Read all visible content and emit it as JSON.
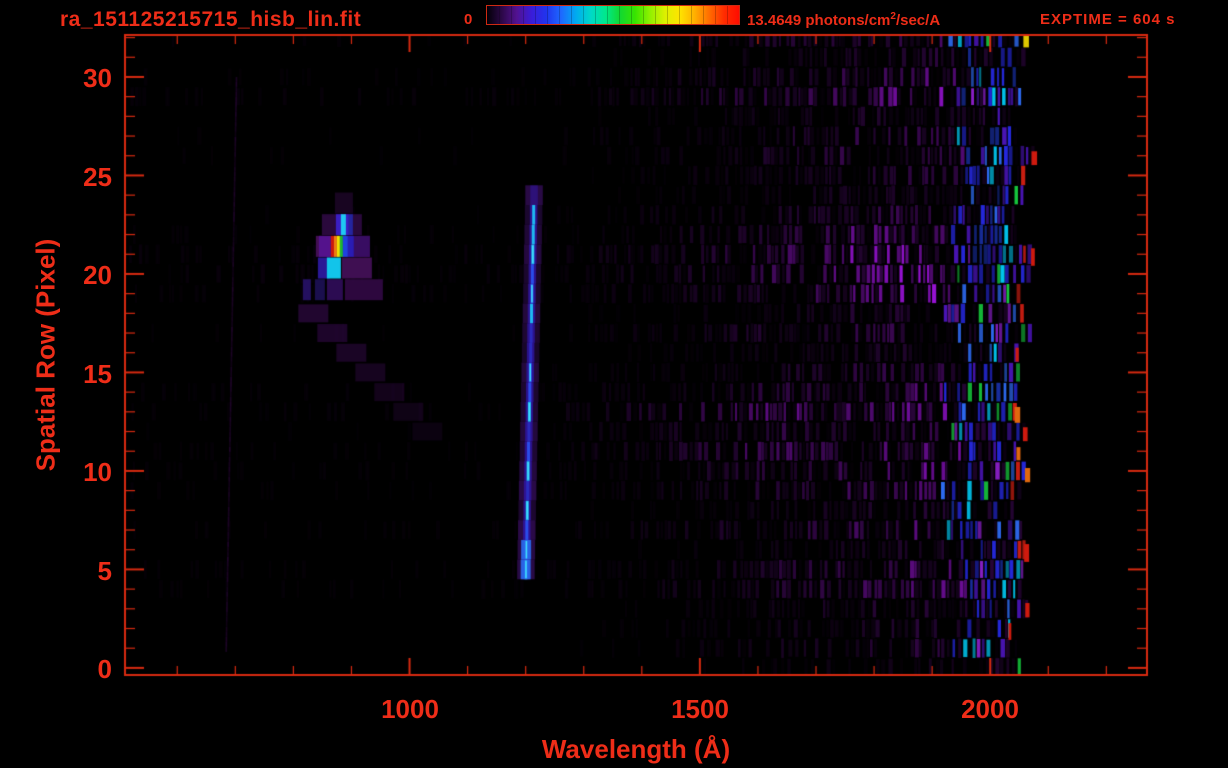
{
  "header": {
    "title": "ra_151125215715_hisb_lin.fit",
    "exptime": "EXPTIME = 604 s"
  },
  "colorbar": {
    "min_label": "0",
    "max_label_pre": "13.4649 photons/cm",
    "max_label_sup": "2",
    "max_label_post": "/sec/A",
    "gradient_stops": [
      "#020006",
      "#2c0848",
      "#521290",
      "#3a1cd8",
      "#2134ee",
      "#1e68ff",
      "#00aaf0",
      "#00d8c8",
      "#00e88c",
      "#12d830",
      "#38e400",
      "#90f000",
      "#dcf000",
      "#ffe400",
      "#ffb000",
      "#ff6c00",
      "#ff2c00",
      "#ff0c00"
    ]
  },
  "axes": {
    "x": {
      "title": "Wavelength (Å)",
      "tick_labels": [
        {
          "value": 1000,
          "label": "1000"
        },
        {
          "value": 1500,
          "label": "1500"
        },
        {
          "value": 2000,
          "label": "2000"
        }
      ]
    },
    "y": {
      "title": "Spatial Row (Pixel)",
      "tick_labels": [
        {
          "value": 30,
          "label": "30"
        },
        {
          "value": 25,
          "label": "25"
        },
        {
          "value": 20,
          "label": "20"
        },
        {
          "value": 15,
          "label": "15"
        },
        {
          "value": 10,
          "label": "10"
        },
        {
          "value": 5,
          "label": "5"
        },
        {
          "value": 0,
          "label": "0"
        }
      ]
    }
  },
  "colors": {
    "text_red": "#ee2d18",
    "line_red": "#d82a10",
    "background": "#000000"
  },
  "chart_data": {
    "type": "heatmap",
    "title": "ra_151125215715_hisb_lin.fit",
    "xlabel": "Wavelength (Å)",
    "ylabel": "Spatial Row (Pixel)",
    "xlim": [
      510,
      2270
    ],
    "ylim": [
      0,
      32
    ],
    "x_major_ticks": [
      1000,
      1500,
      2000
    ],
    "x_minor_step": 100,
    "y_major_ticks": [
      0,
      5,
      10,
      15,
      20,
      25,
      30
    ],
    "y_minor_step": 1,
    "colorbar": {
      "min": 0,
      "max": 13.4649,
      "units": "photons/cm2/sec/A",
      "colormap": "rainbow"
    },
    "exposure_time_s": 604,
    "features": [
      {
        "name": "emission-blob",
        "wavelength_A": [
          855,
          930
        ],
        "rows": [
          19,
          23.5
        ],
        "description": "bright saturated emission knot stepping down-left; rainbow (red-orange-yellow-green-blue) core near 870 Å at row ~21.5, cyan-blue segments above and below"
      },
      {
        "name": "lyman-alpha-line",
        "wavelength_A": [
          1198,
          1222
        ],
        "rows": [
          5,
          24
        ],
        "description": "bright blue/cyan vertical emission line with purple wings, slight tilt blueward toward lower rows"
      },
      {
        "name": "faint-vertical-line",
        "wavelength_A": [
          700,
          704
        ],
        "rows": [
          1,
          30
        ],
        "description": "very faint dark-purple column spanning nearly full height"
      },
      {
        "name": "diagonal-streak",
        "wavelength_A": [
          830,
          1050
        ],
        "rows": [
          12,
          19
        ],
        "description": "faint purple streak descending from the emission knot toward longer wavelengths"
      },
      {
        "name": "long-wavelength-edge",
        "wavelength_A": [
          1930,
          2075
        ],
        "rows": [
          0,
          31
        ],
        "description": "dense saturated blue/purple stripes with occasional cyan, green, red and orange tips; jagged cutoff near 2065 Å, black beyond"
      },
      {
        "name": "diffuse-background",
        "wavelength_A": [
          560,
          2060
        ],
        "rows": [
          0,
          32
        ],
        "description": "faint purple vertical striping noise per spatial row, brightening toward long wavelengths; brightest around rows 19-21"
      }
    ]
  }
}
